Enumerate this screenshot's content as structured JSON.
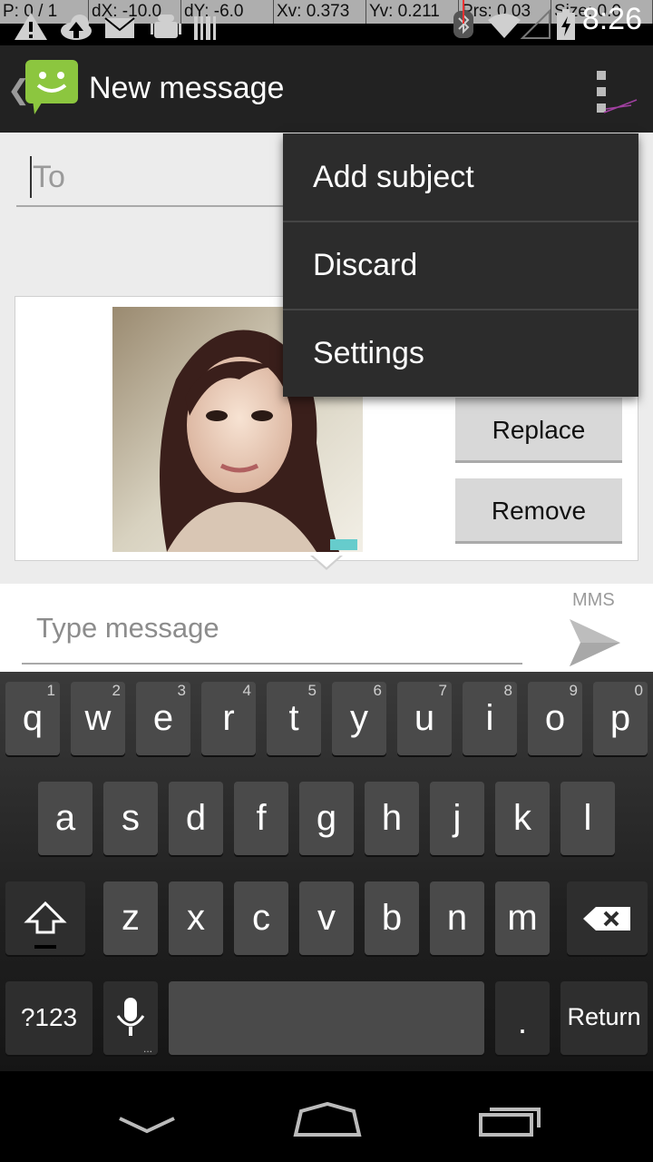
{
  "status_bar": {
    "debug_fields": [
      "P: 0 / 1",
      "dX: -10.0",
      "dY: -6.0",
      "Xv: 0.373",
      "Yv: 0.211",
      "Prs: 0.03",
      "Size: 0.0"
    ],
    "time": "8:26"
  },
  "action_bar": {
    "title": "New message",
    "app_icon": "messaging-app-icon",
    "overflow_icon": "overflow-menu-icon"
  },
  "compose": {
    "to_placeholder": "To",
    "attachment": {
      "replace_label": "Replace",
      "remove_label": "Remove"
    },
    "message_placeholder": "Type message",
    "message_type": "MMS",
    "send_icon": "send-icon"
  },
  "overflow_menu": {
    "items": [
      {
        "label": "Add subject"
      },
      {
        "label": "Discard"
      },
      {
        "label": "Settings"
      }
    ]
  },
  "keyboard": {
    "row1": [
      {
        "key": "q",
        "hint": "1"
      },
      {
        "key": "w",
        "hint": "2"
      },
      {
        "key": "e",
        "hint": "3"
      },
      {
        "key": "r",
        "hint": "4"
      },
      {
        "key": "t",
        "hint": "5"
      },
      {
        "key": "y",
        "hint": "6"
      },
      {
        "key": "u",
        "hint": "7"
      },
      {
        "key": "i",
        "hint": "8"
      },
      {
        "key": "o",
        "hint": "9"
      },
      {
        "key": "p",
        "hint": "0"
      }
    ],
    "row2": [
      "a",
      "s",
      "d",
      "f",
      "g",
      "h",
      "j",
      "k",
      "l"
    ],
    "row3": [
      "z",
      "x",
      "c",
      "v",
      "b",
      "n",
      "m"
    ],
    "symbols_label": "?123",
    "period_label": ".",
    "return_label": "Return"
  }
}
